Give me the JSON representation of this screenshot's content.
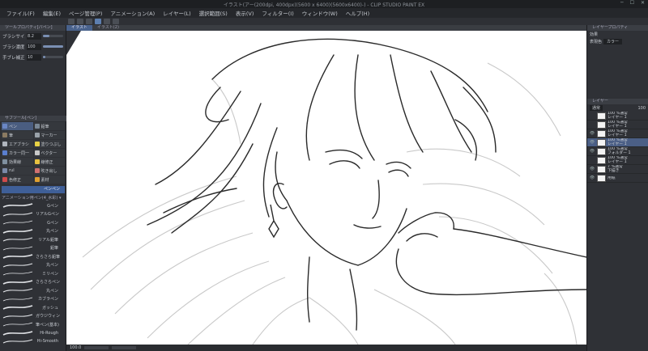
{
  "title": "イラスト(アー(200dpi, 400dpx)(5600 x 6400)(5600x6400)-) - CLIP STUDIO PAINT EX",
  "menu": [
    "ファイル(F)",
    "編集(E)",
    "ページ管理(P)",
    "アニメーション(A)",
    "レイヤー(L)",
    "選択範囲(S)",
    "表示(V)",
    "フィルター(I)",
    "ウィンドウ(W)",
    "ヘルプ(H)"
  ],
  "tool_property": {
    "header": "ツールプロパティ[パペン]",
    "brush_size_label": "ブラシサイズ",
    "brush_size_value": "8.2",
    "brush_density_label": "ブラシ濃度",
    "brush_density_value": "100",
    "stabilization_label": "手ブレ補正",
    "stabilization_value": "10"
  },
  "sub_tool": {
    "header": "サブツール[ペン]",
    "tools": [
      {
        "label": "ペン",
        "color": "#6a86c4",
        "selected": true
      },
      {
        "label": "鉛筆",
        "color": "#7a8896",
        "selected": false
      },
      {
        "label": "筆",
        "color": "#8a7a62",
        "selected": false
      },
      {
        "label": "マーカー",
        "color": "#9aa2aa",
        "selected": false
      },
      {
        "label": "エアブラシ",
        "color": "#b0b6be",
        "selected": false
      },
      {
        "label": "塗りつぶし",
        "color": "#e8d245",
        "selected": false
      },
      {
        "label": "カラー同一",
        "color": "#5a7fd0",
        "selected": false
      },
      {
        "label": "ベクター",
        "color": "#c8c8c8",
        "selected": false
      },
      {
        "label": "効果線",
        "color": "#8090a0",
        "selected": false
      },
      {
        "label": "線修正",
        "color": "#e8c140",
        "selected": false
      },
      {
        "label": "rul",
        "color": "#7b8aa8",
        "selected": false
      },
      {
        "label": "吹き出し",
        "color": "#d07070",
        "selected": false
      },
      {
        "label": "色修正",
        "color": "#d04c4c",
        "selected": false
      },
      {
        "label": "素材",
        "color": "#e0a030",
        "selected": false
      }
    ],
    "selected_label": "ペンペン",
    "list_header": "アニメーション用ペン(4_水彩) ▾",
    "brushes": [
      "Gペン",
      "リアルGペン",
      "Gペン",
      "丸ペン",
      "リアル鉛筆",
      "鉛筆",
      "さらさら鉛筆",
      "丸ペン",
      "ミリペン",
      "さらさらペン",
      "丸ペン",
      "カブラペン",
      "ガッシュ",
      "ガウジウィン",
      "筆ペン(基本)",
      "Hi-Rough",
      "Hi-Smooth"
    ]
  },
  "canvas": {
    "tabs": [
      "イラスト",
      "イラスト(2)"
    ],
    "zoom": "100.0"
  },
  "right_panel": {
    "sub_view_header": "レイヤープロパティ",
    "effect_label": "効果",
    "color_label": "表現色",
    "color_value": "カラー",
    "layer_header": "レイヤー",
    "blend_mode": "通常",
    "opacity": "100",
    "layers": [
      {
        "eye": "",
        "percent": "100 %通常",
        "name": "レイヤー 1",
        "selected": false
      },
      {
        "eye": "",
        "percent": "100 %通常",
        "name": "レイヤー 1",
        "selected": false
      },
      {
        "eye": "👁",
        "percent": "100 %通常",
        "name": "レイヤー 1",
        "selected": false
      },
      {
        "eye": "👁",
        "percent": "100 %通常",
        "name": "レイヤー 1",
        "selected": true
      },
      {
        "eye": "👁",
        "percent": "100 %通常",
        "name": "フォルダー 1",
        "selected": false
      },
      {
        "eye": "",
        "percent": "100 %通常",
        "name": "レイヤー 1",
        "selected": false
      },
      {
        "eye": "👁",
        "percent": "7 %通常",
        "name": "下描き",
        "selected": false
      },
      {
        "eye": "👁",
        "percent": "",
        "name": "用紙",
        "selected": false
      }
    ]
  }
}
